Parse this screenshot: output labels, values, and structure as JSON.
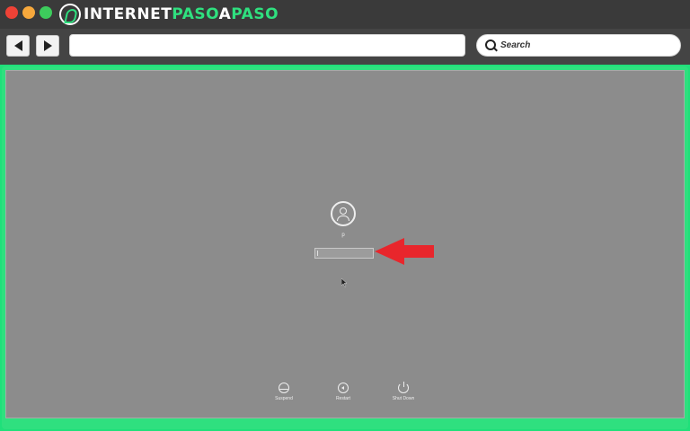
{
  "browser": {
    "brand": {
      "part1": "INTERNET",
      "part2": "PASO",
      "part3": "A",
      "part4": "PASO"
    },
    "url": "",
    "search_label": "Search",
    "icons": {
      "back": "back-arrow-icon",
      "forward": "forward-arrow-icon",
      "search": "search-icon"
    }
  },
  "login_screen": {
    "username": "p",
    "password_value": "",
    "power_options": [
      {
        "label": "Suspend",
        "icon": "suspend-icon"
      },
      {
        "label": "Restart",
        "icon": "restart-icon"
      },
      {
        "label": "Shut Down",
        "icon": "shutdown-icon"
      }
    ]
  },
  "colors": {
    "accent_green": "#2fe07f",
    "annotation_red": "#e8262c",
    "screen_gray": "#8c8c8c"
  }
}
